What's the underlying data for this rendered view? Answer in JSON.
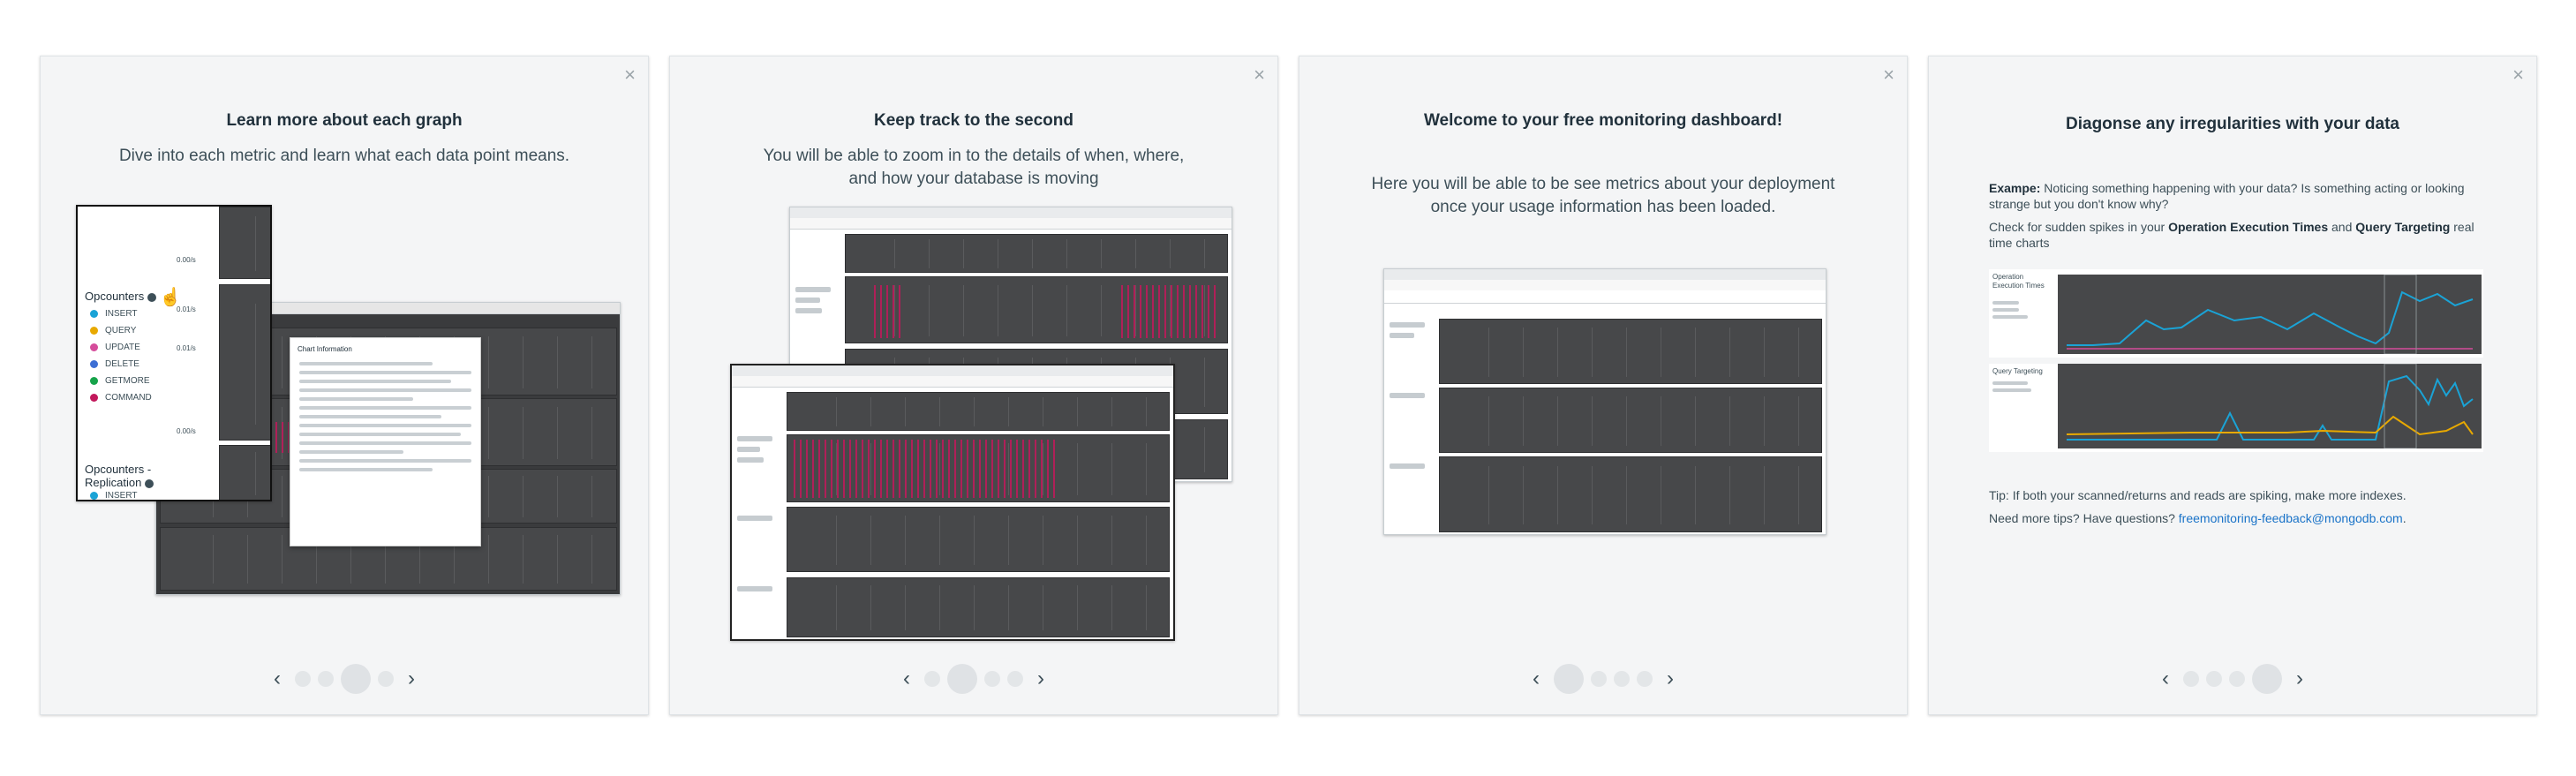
{
  "cards": [
    {
      "title": "Learn more about each graph",
      "description": "Dive into each metric and learn what each data point means.",
      "close": "×",
      "screenshot": {
        "opcounters_title": "Opcounters",
        "opcounters_items": [
          "INSERT",
          "QUERY",
          "UPDATE",
          "DELETE",
          "GETMORE",
          "COMMAND"
        ],
        "opcounters_colors": [
          "#1aa3d6",
          "#e8a900",
          "#d54c9b",
          "#3d6fd4",
          "#16a34a",
          "#c2185b"
        ],
        "replication_title": "Opcounters - Replication",
        "replication_first": "INSERT",
        "rates": [
          "0.00/s",
          "0.01/s",
          "0.01/s",
          "0.00/s"
        ],
        "panel_title": "Chart Information"
      }
    },
    {
      "title": "Keep track to the second",
      "description": "You will be able to zoom in to the details of when, where, and how your database is moving"
    },
    {
      "title": "Welcome to your free monitoring dashboard!",
      "description": "Here you will be able to be see metrics about your deployment once your usage information has been loaded."
    },
    {
      "title": "Diagonse any irregularities with your data",
      "example_label": "Exampe:",
      "example_text": "Noticing something happening with your data? Is something acting or looking strange but you don't know why?",
      "check_prefix": "Check for sudden spikes in your",
      "check_bold1": "Operation Execution Times",
      "check_and": "and",
      "check_bold2": "Query Targeting",
      "check_suffix": "real time charts",
      "tip": "Tip: If both your scanned/returns and reads are spiking, make more indexes.",
      "need_more": "Need more tips? Have questions?",
      "email": "freemonitoring-feedback@mongodb.com",
      "email_end": ".",
      "chart_labels": [
        "Operation Execution Times",
        "Query Targeting"
      ]
    }
  ],
  "pager": {
    "prev": "‹",
    "next": "›",
    "active_index": [
      2,
      1,
      0,
      3
    ]
  },
  "colors": {
    "accent_link": "#1a73c8",
    "chart_bg": "#47484a",
    "line_blue": "#1aa3d6",
    "line_orange": "#e8a900",
    "spike_pink": "#c2185b"
  }
}
